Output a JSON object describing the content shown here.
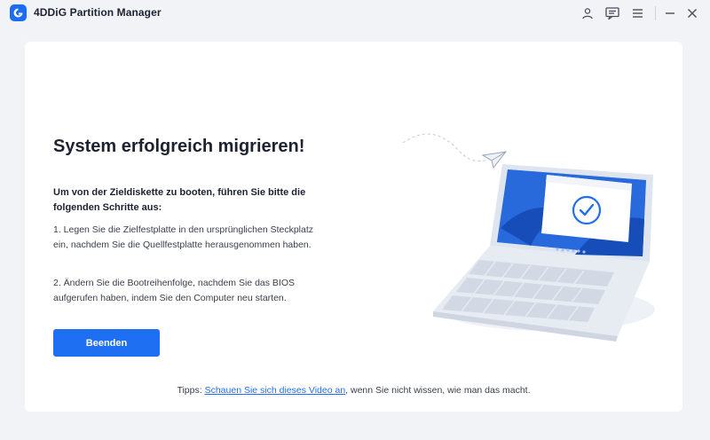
{
  "app": {
    "title": "4DDiG Partition Manager"
  },
  "titlebar": {
    "icons": [
      "user-icon",
      "feedback-icon",
      "menu-icon",
      "minimize-icon",
      "close-icon"
    ]
  },
  "main": {
    "headline": "System erfolgreich migrieren!",
    "instructions_title": "Um von der Zieldiskette zu booten, führen Sie bitte die folgenden Schritte aus:",
    "steps": [
      "1. Legen Sie die Zielfestplatte in den ursprünglichen Steckplatz ein, nachdem Sie die Quellfestplatte herausgenommen haben.",
      "2. Ändern Sie die Bootreihenfolge, nachdem Sie das BIOS aufgerufen haben, indem Sie den Computer neu starten."
    ],
    "finish_button": "Beenden"
  },
  "tips": {
    "prefix": "Tipps: ",
    "link": "Schauen Sie sich dieses Video an",
    "suffix": ", wenn Sie nicht wissen, wie man das macht."
  },
  "colors": {
    "accent": "#1f6ff2",
    "background": "#f1f3f7",
    "card": "#ffffff"
  },
  "illustration": {
    "icons": [
      "laptop-illustration",
      "checkmark-icon",
      "paper-plane-icon"
    ]
  }
}
